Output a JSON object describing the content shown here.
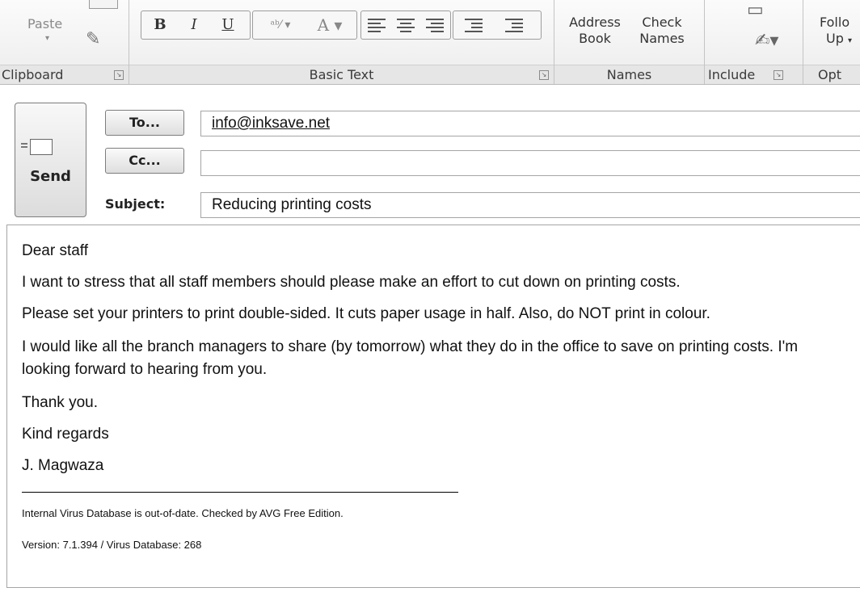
{
  "ribbon": {
    "clipboard": {
      "paste_label": "Paste",
      "group_label": "Clipboard"
    },
    "basic_text": {
      "group_label": "Basic Text",
      "bold": "B",
      "italic": "I",
      "underline": "U"
    },
    "names": {
      "address_book_line1": "Address",
      "address_book_line2": "Book",
      "check_names_line1": "Check",
      "check_names_line2": "Names",
      "group_label": "Names"
    },
    "include": {
      "group_label": "Include"
    },
    "options": {
      "follow_up_line1": "Follo",
      "follow_up_line2": "Up",
      "group_label": "Opt"
    }
  },
  "compose": {
    "send_label": "Send",
    "to_button": "To...",
    "cc_button": "Cc...",
    "subject_label": "Subject:",
    "to_value": "info@inksave.net",
    "cc_value": "",
    "subject_value": "Reducing printing costs"
  },
  "message": {
    "greeting": "Dear staff",
    "para1": "I want to stress that all staff members should please make an effort to cut down on printing costs.",
    "para2": "Please set your printers to print double-sided. It cuts paper usage in half. Also, do NOT print in colour.",
    "para3": "I would like all the branch managers to share (by tomorrow) what they do in the office to save on printing costs. I'm looking forward to hearing from you.",
    "thanks": "Thank you.",
    "closing": "Kind regards",
    "signature": "J. Magwaza",
    "footer_line1": "Internal Virus Database is out-of-date. Checked by AVG Free Edition.",
    "footer_line2": "Version: 7.1.394 / Virus Database: 268"
  }
}
